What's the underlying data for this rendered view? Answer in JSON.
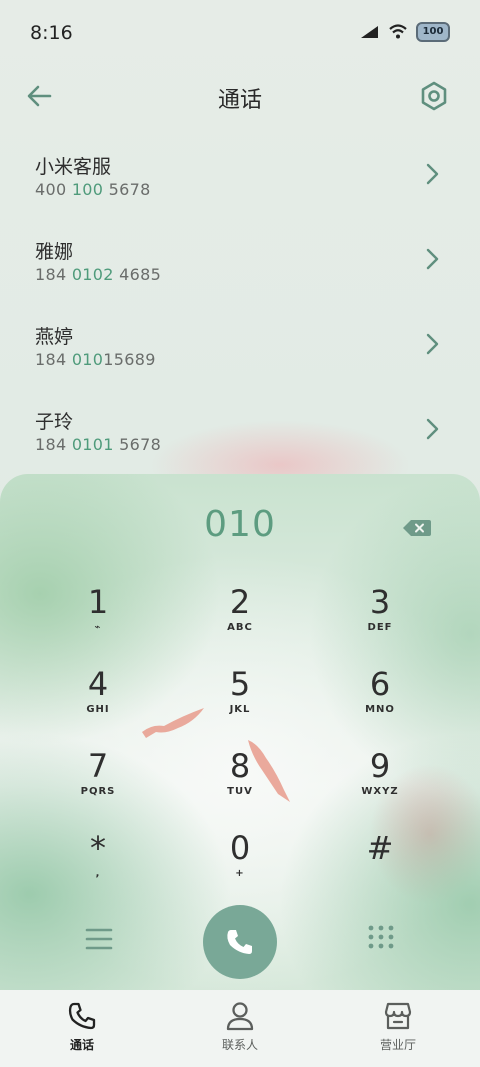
{
  "status_bar": {
    "time": "8:16",
    "battery": "100"
  },
  "header": {
    "title": "通话"
  },
  "contacts": [
    {
      "name": "小米客服",
      "number_parts": [
        "400 ",
        "100",
        " 5678"
      ]
    },
    {
      "name": "雅娜",
      "number_parts": [
        "184 ",
        "0102",
        " 4685"
      ]
    },
    {
      "name": "燕婷",
      "number_parts": [
        "184 ",
        "010",
        "15689"
      ]
    },
    {
      "name": "子玲",
      "number_parts": [
        "184 ",
        "0101",
        " 5678"
      ]
    }
  ],
  "dialpad": {
    "entered_number": "010",
    "keys": [
      {
        "digit": "1",
        "letters": "⌁"
      },
      {
        "digit": "2",
        "letters": "ABC"
      },
      {
        "digit": "3",
        "letters": "DEF"
      },
      {
        "digit": "4",
        "letters": "GHI"
      },
      {
        "digit": "5",
        "letters": "JKL"
      },
      {
        "digit": "6",
        "letters": "MNO"
      },
      {
        "digit": "7",
        "letters": "PQRS"
      },
      {
        "digit": "8",
        "letters": "TUV"
      },
      {
        "digit": "9",
        "letters": "WXYZ"
      },
      {
        "digit": "*",
        "letters": ","
      },
      {
        "digit": "0",
        "letters": "+"
      },
      {
        "digit": "#",
        "letters": ""
      }
    ]
  },
  "bottom_nav": [
    {
      "label": "通话",
      "icon": "phone-icon",
      "active": true
    },
    {
      "label": "联系人",
      "icon": "person-icon",
      "active": false
    },
    {
      "label": "营业厅",
      "icon": "store-icon",
      "active": false
    }
  ],
  "colors": {
    "accent": "#5d9c80",
    "call_button": "#79a897",
    "highlight": "#4f9b7b"
  }
}
